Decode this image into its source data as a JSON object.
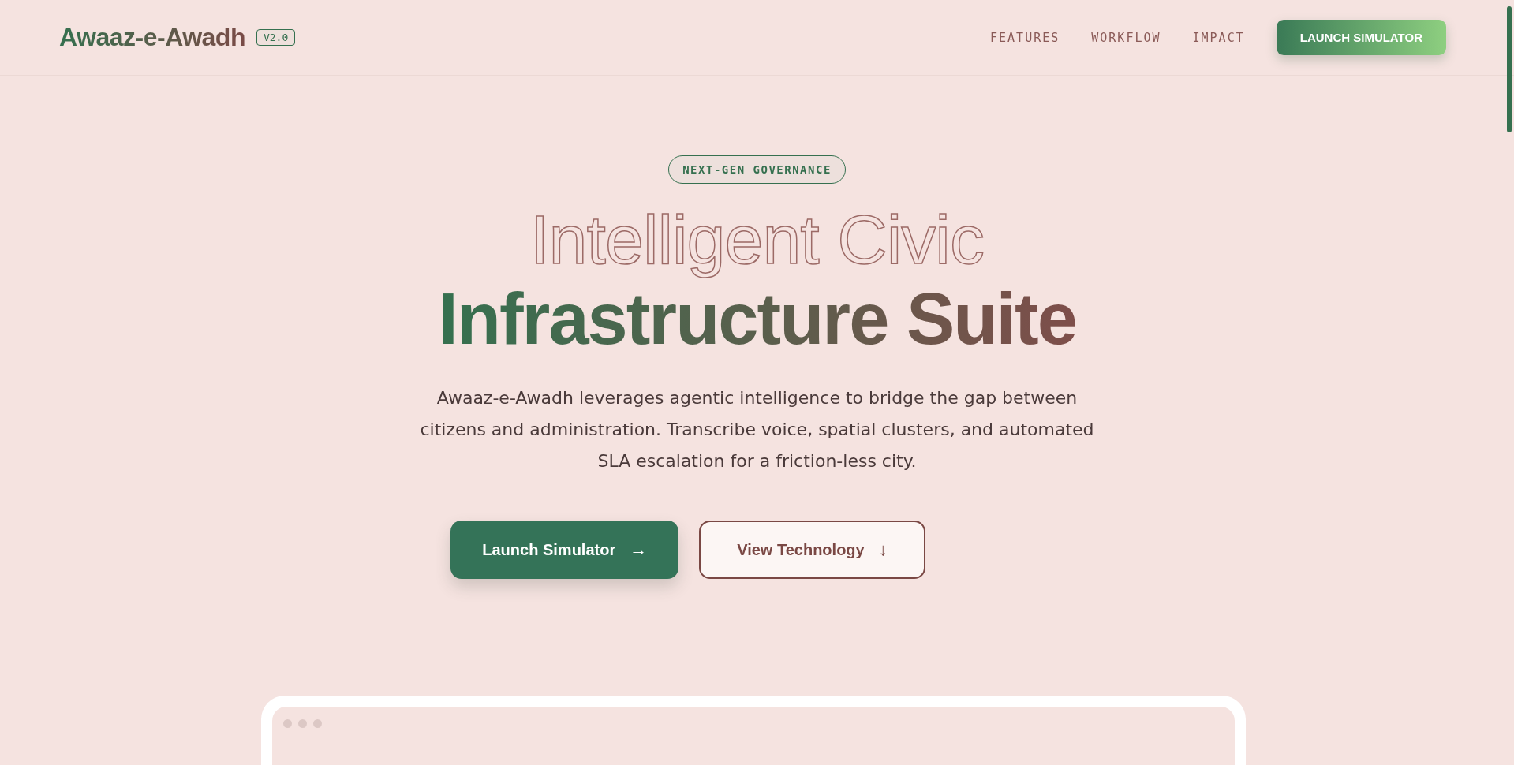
{
  "header": {
    "logo": "Awaaz-e-Awadh",
    "version": "V2.0",
    "nav": [
      {
        "label": "FEATURES"
      },
      {
        "label": "WORKFLOW"
      },
      {
        "label": "IMPACT"
      }
    ],
    "cta": "LAUNCH SIMULATOR"
  },
  "hero": {
    "badge": "NEXT-GEN GOVERNANCE",
    "title_outline": "Intelligent Civic",
    "title_solid": "Infrastructure Suite",
    "description": "Awaaz-e-Awadh leverages agentic intelligence to bridge the gap between citizens and administration. Transcribe voice, spatial clusters, and automated SLA escalation for a friction-less city.",
    "buttons": [
      {
        "kind": "primary",
        "label": "Launch Simulator",
        "icon": "→"
      },
      {
        "kind": "secondary",
        "label": "View Technology",
        "icon": "↓"
      }
    ]
  }
}
